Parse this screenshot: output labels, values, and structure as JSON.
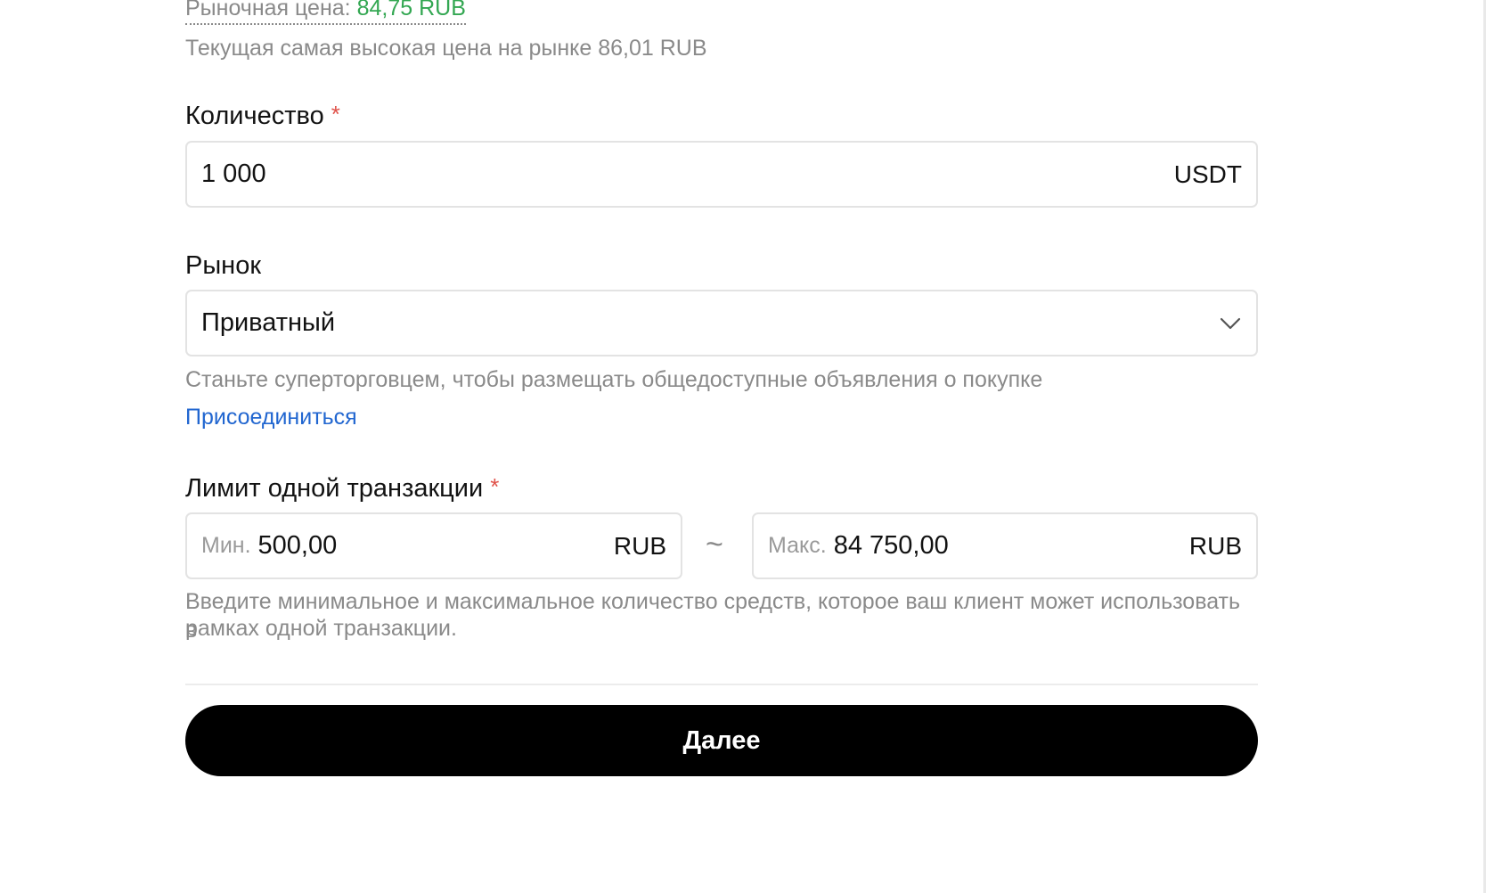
{
  "market_price": {
    "label": "Рыночная цена:",
    "value": "84,75 RUB"
  },
  "highest_price": {
    "text": "Текущая самая высокая цена на рынке",
    "value": "86,01 RUB"
  },
  "quantity": {
    "label": "Количество",
    "required": "*",
    "value": "1 000",
    "currency": "USDT"
  },
  "market": {
    "label": "Рынок",
    "selected": "Приватный",
    "hint": "Станьте суперторговцем, чтобы размещать общедоступные объявления о покупке",
    "join_link": "Присоединиться"
  },
  "limit": {
    "label": "Лимит одной транзакции",
    "required": "*",
    "min_prefix": "Мин.",
    "min_value": "500,00",
    "min_currency": "RUB",
    "separator": "~",
    "max_prefix": "Макс.",
    "max_value": "84 750,00",
    "max_currency": "RUB",
    "hint_line1": "Введите минимальное и максимальное количество средств, которое ваш клиент может использовать в",
    "hint_line2": "рамках одной транзакции."
  },
  "next_button": {
    "label": "Далее"
  },
  "colors": {
    "accent_green": "#33a752",
    "link_blue": "#2166d0",
    "required_red": "#e0524a",
    "button_black": "#000000"
  }
}
